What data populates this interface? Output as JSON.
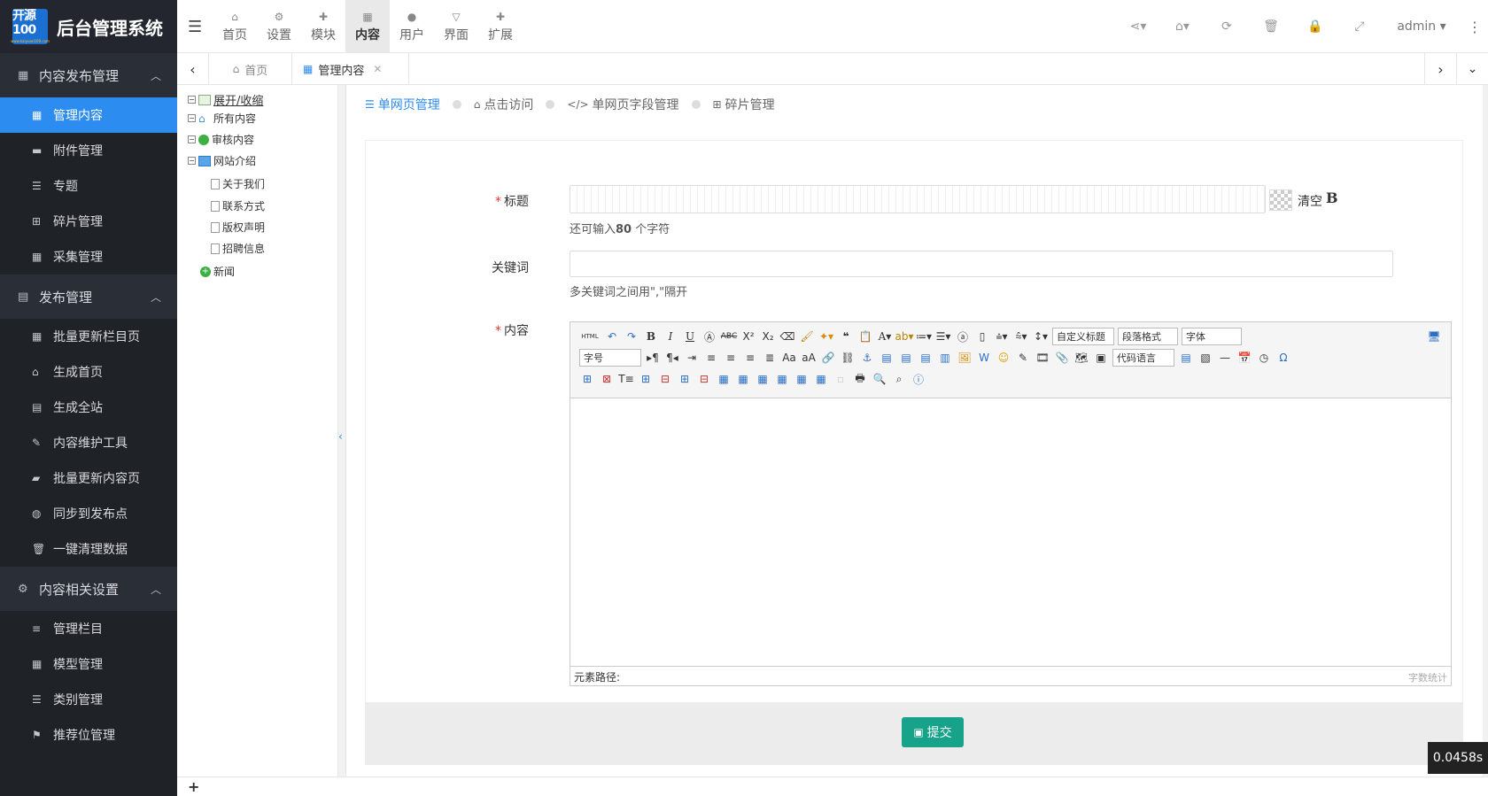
{
  "app": {
    "logo_top": "开源100",
    "logo_sub": "www.kaiyuan100.com",
    "title": "后台管理系统"
  },
  "sidebar": {
    "groups": [
      {
        "label": "内容发布管理",
        "items": [
          "管理内容",
          "附件管理",
          "专题",
          "碎片管理",
          "采集管理"
        ]
      },
      {
        "label": "发布管理",
        "items": [
          "批量更新栏目页",
          "生成首页",
          "生成全站",
          "内容维护工具",
          "批量更新内容页",
          "同步到发布点",
          "一键清理数据"
        ]
      },
      {
        "label": "内容相关设置",
        "items": [
          "管理栏目",
          "模型管理",
          "类别管理",
          "推荐位管理"
        ]
      }
    ]
  },
  "topnav": [
    "首页",
    "设置",
    "模块",
    "内容",
    "用户",
    "界面",
    "扩展"
  ],
  "topnav_active": "内容",
  "user": "admin",
  "tabs": [
    {
      "label": "首页"
    },
    {
      "label": "管理内容"
    }
  ],
  "tree": {
    "toggle": "展开/收缩",
    "nodes": [
      "所有内容",
      "审核内容",
      "网站介绍",
      "关于我们",
      "联系方式",
      "版权声明",
      "招聘信息",
      "新闻"
    ]
  },
  "subtabs": [
    "单网页管理",
    "点击访问",
    "单网页字段管理",
    "碎片管理"
  ],
  "form": {
    "title_label": "标题",
    "title_clear": "清空",
    "title_bold": "B",
    "title_hint_pre": "还可输入",
    "title_hint_num": "80",
    "title_hint_post": " 个字符",
    "keywords_label": "关键词",
    "keywords_hint": "多关键词之间用\",\"隔开",
    "content_label": "内容",
    "editor": {
      "html_btn": "HTML",
      "custom_title": "自定义标题",
      "paragraph": "段落格式",
      "font": "字体",
      "font_size": "字号",
      "code_lang": "代码语言",
      "path_label": "元素路径:",
      "word_count": "字数统计"
    },
    "submit": "提交"
  },
  "timer": "0.0458s",
  "colors": {
    "accent": "#2d8cf0",
    "sidebar": "#1f2227",
    "submit": "#16a38a"
  }
}
